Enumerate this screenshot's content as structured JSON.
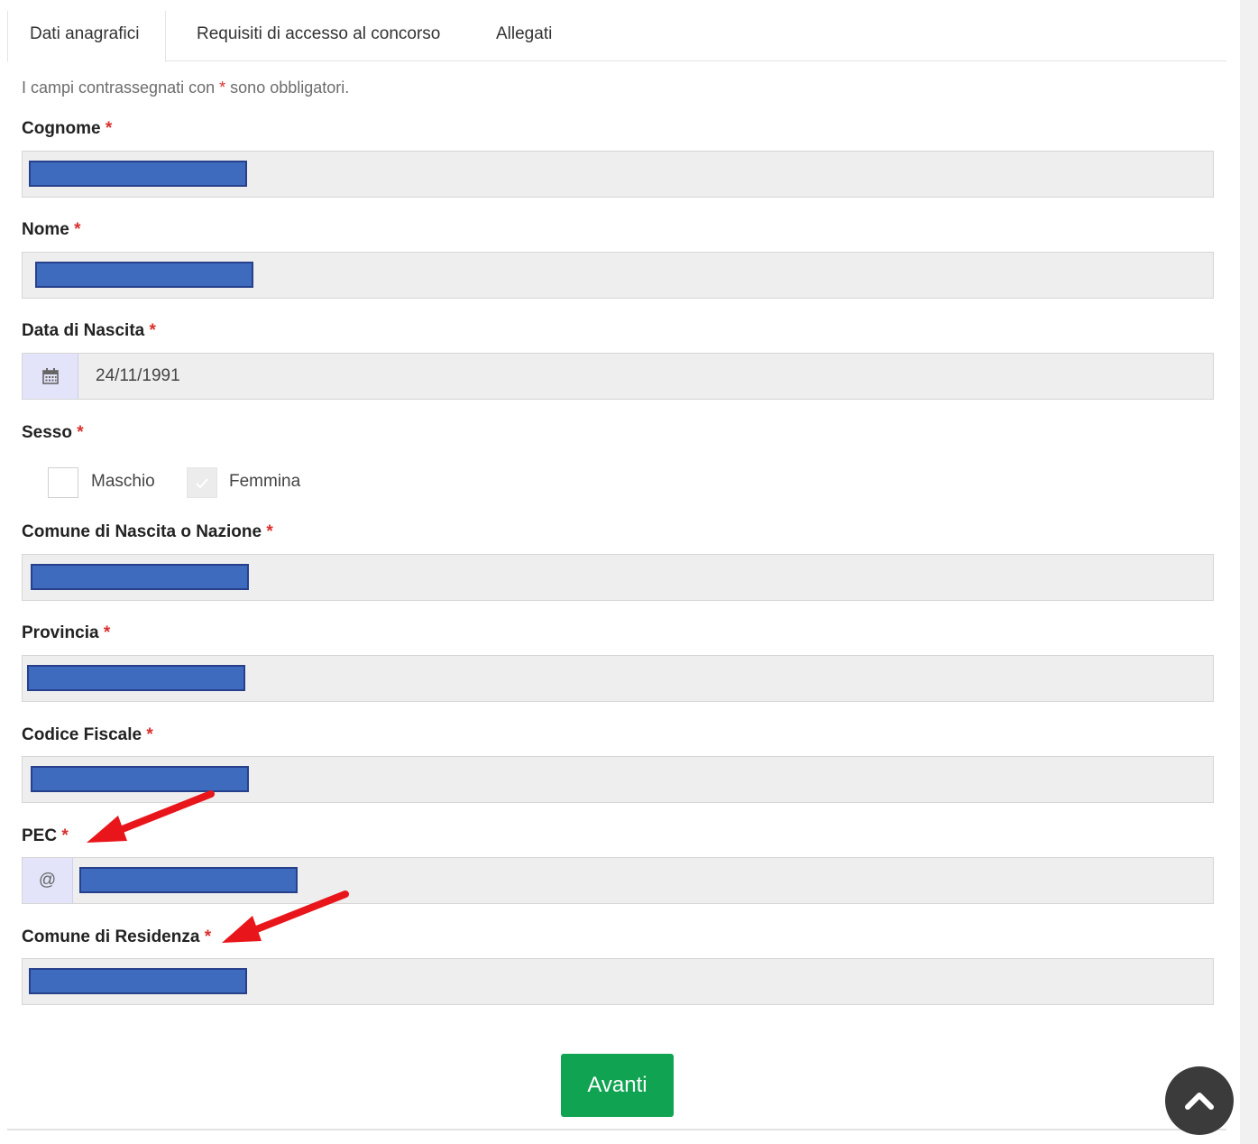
{
  "tabs": [
    {
      "label": "Dati anagrafici",
      "active": true
    },
    {
      "label": "Requisiti di accesso al concorso",
      "active": false
    },
    {
      "label": "Allegati",
      "active": false
    }
  ],
  "form": {
    "note_prefix": "I campi contrassegnati con",
    "note_star": "*",
    "note_suffix": "sono obbligatori.",
    "required_mark": "*",
    "fields": {
      "cognome": {
        "label": "Cognome",
        "value": "",
        "redacted": true
      },
      "nome": {
        "label": "Nome",
        "value": "",
        "redacted": true
      },
      "data_nascita": {
        "label": "Data di Nascita",
        "value": "24/11/1991",
        "icon": "calendar-icon"
      },
      "sesso": {
        "label": "Sesso",
        "options": [
          {
            "label": "Maschio",
            "checked": false
          },
          {
            "label": "Femmina",
            "checked": true
          }
        ]
      },
      "comune_nascita": {
        "label": "Comune di Nascita o Nazione",
        "value": "",
        "redacted": true
      },
      "provincia": {
        "label": "Provincia",
        "value": "",
        "redacted": true
      },
      "codice_fiscale": {
        "label": "Codice Fiscale",
        "value": "",
        "redacted": true
      },
      "pec": {
        "label": "PEC",
        "addon": "@",
        "value": "",
        "redacted": true
      },
      "comune_residenza": {
        "label": "Comune di Residenza",
        "value": "",
        "redacted": true
      }
    }
  },
  "actions": {
    "next_label": "Avanti"
  },
  "scroll_top": {
    "icon": "chevron-up-icon"
  },
  "annotations": {
    "arrow_color": "#e8161b",
    "count": 2
  },
  "colors": {
    "required": "#d9302c",
    "primary_button": "#10a352",
    "redaction": "#3f6bbf",
    "input_bg": "#eeeeee",
    "addon_bg": "#e3e4f9"
  }
}
